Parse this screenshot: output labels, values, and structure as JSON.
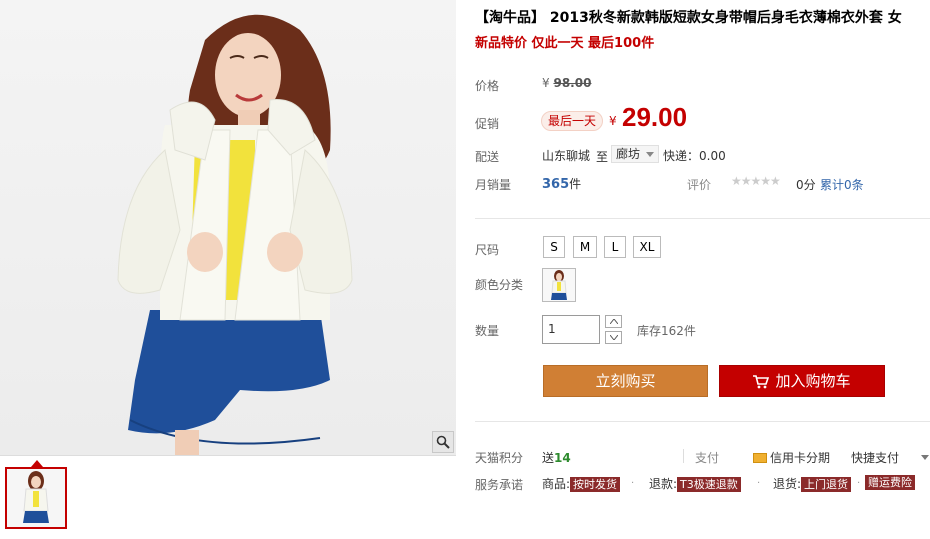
{
  "product": {
    "title": "【淘牛品】 2013秋冬新款韩版短款女身带帽后身毛衣薄棉衣外套 女",
    "subtitle": "新品特价 仅此一天 最后100件"
  },
  "price": {
    "list_label": "价格",
    "currency": "¥",
    "list_price": "98.00",
    "promo_label": "促销",
    "promo_tag": "最后一天",
    "promo_price": "29.00"
  },
  "shipping": {
    "label": "配送",
    "from": "山东聊城",
    "to_word": "至",
    "to_city": "廊坊",
    "express": "快递：0.00"
  },
  "sales": {
    "label": "月销量",
    "count": "365",
    "unit": "件",
    "rating_label": "评价",
    "stars": "★★★★★",
    "score": "0分",
    "reviews": "累计0条"
  },
  "size": {
    "label": "尺码",
    "options": [
      "S",
      "M",
      "L",
      "XL"
    ]
  },
  "color": {
    "label": "颜色分类"
  },
  "quantity": {
    "label": "数量",
    "value": "1",
    "stock": "库存162件"
  },
  "actions": {
    "buy": "立刻购买",
    "cart": "加入购物车"
  },
  "footer": {
    "points_label": "天猫积分",
    "points_send": "送",
    "points_value": "14",
    "pay_label": "支付",
    "credit": "信用卡分期",
    "quickpay": "快捷支付",
    "service_label": "服务承诺",
    "goods_prefix": "商品:",
    "goods_tag": "按时发货",
    "refund_prefix": "退款:",
    "refund_tag": "T3极速退款",
    "return_prefix": "退货:",
    "return_tag1": "上门退货",
    "return_tag2": "赠运费险"
  },
  "colors": {
    "accent_red": "#c40000",
    "buy_orange": "#d07f34",
    "link_blue": "#3366aa"
  }
}
